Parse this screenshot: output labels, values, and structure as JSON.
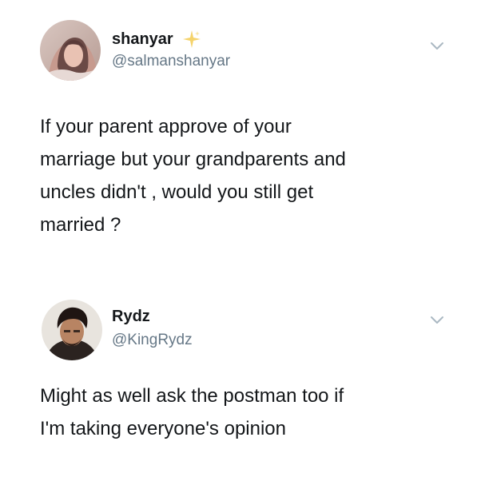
{
  "tweets": [
    {
      "display_name": "shanyar",
      "handle": "@salmanshanyar",
      "verified_sparkle_icon": "sparkle-icon",
      "text": "If your parent approve of your\nmarriage but your grandparents and\nuncles didn't , would you still get\nmarried ?",
      "menu_icon": "chevron-down-icon"
    },
    {
      "display_name": "Rydz",
      "handle": "@KingRydz",
      "text": "Might as well ask the postman too if\nI'm taking everyone's opinion",
      "menu_icon": "chevron-down-icon"
    }
  ],
  "colors": {
    "text_primary": "#14171a",
    "text_secondary": "#657786",
    "sparkle": "#f5d36b",
    "background": "#ffffff"
  }
}
